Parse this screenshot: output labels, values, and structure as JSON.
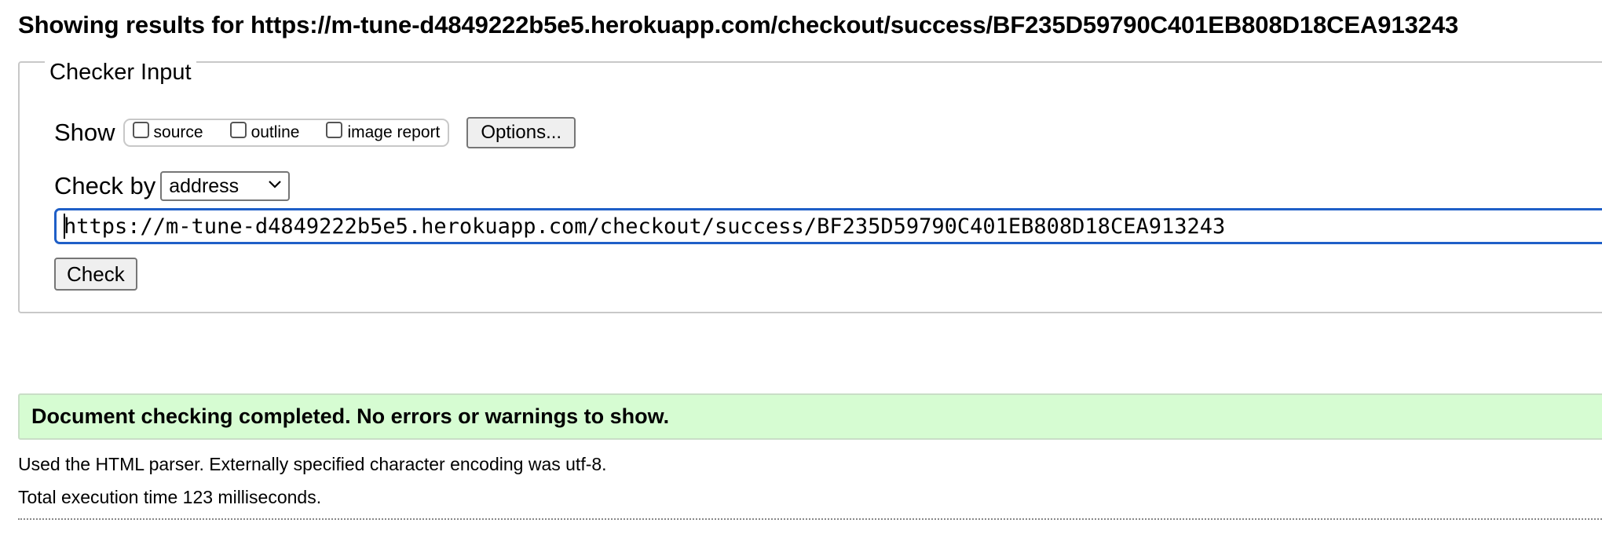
{
  "results": {
    "heading": "Showing results for https://m-tune-d4849222b5e5.herokuapp.com/checkout/success/BF235D59790C401EB808D18CEA913243"
  },
  "checker": {
    "legend": "Checker Input",
    "show_label": "Show",
    "options": [
      {
        "label": "source",
        "checked": false
      },
      {
        "label": "outline",
        "checked": false
      },
      {
        "label": "image report",
        "checked": false
      }
    ],
    "options_button": "Options...",
    "check_by_label": "Check by",
    "check_by_selected": "address",
    "url_value": "https://m-tune-d4849222b5e5.herokuapp.com/checkout/success/BF235D59790C401EB808D18CEA913243",
    "check_button": "Check"
  },
  "status": {
    "message": "Document checking completed. No errors or warnings to show.",
    "parser_info": "Used the HTML parser. Externally specified character encoding was utf-8.",
    "execution_time": "Total execution time 123 milliseconds."
  },
  "colors": {
    "success_background": "#d6fcd2",
    "input_focus_border": "#1f5fc7"
  }
}
